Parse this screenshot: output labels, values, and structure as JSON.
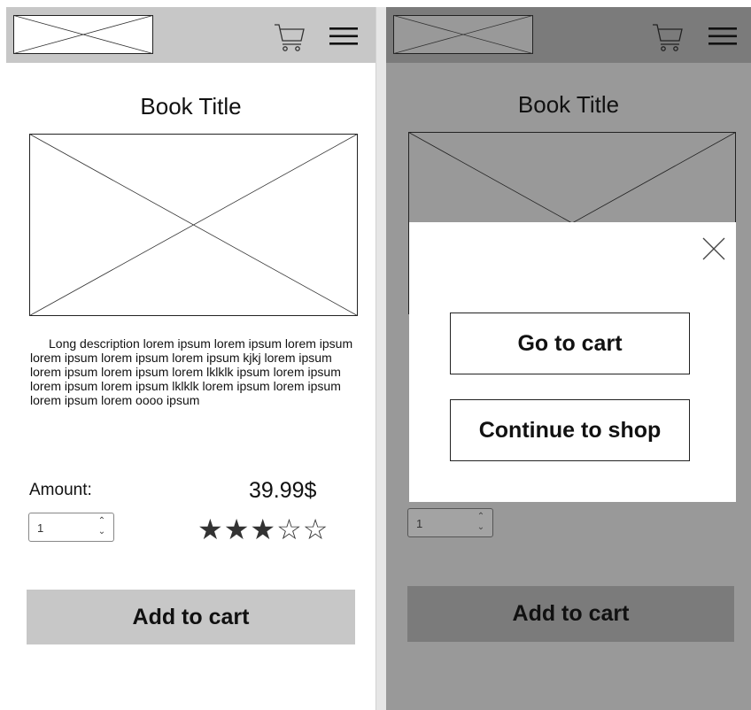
{
  "screens": {
    "product": {
      "book_title": "Book Title",
      "description": "Long description lorem ipsum lorem ipsum lorem ipsum lorem ipsum lorem ipsum lorem ipsum kjkj lorem ipsum lorem ipsum lorem ipsum lorem lklklk ipsum lorem ipsum lorem ipsum lorem ipsum lklklk lorem ipsum lorem ipsum lorem ipsum lorem oooo ipsum",
      "amount_label": "Amount:",
      "price": "39.99$",
      "quantity": "1",
      "rating": {
        "filled": 3,
        "total": 5,
        "display": "★★★☆☆"
      },
      "add_to_cart_label": "Add to cart",
      "icons": {
        "logo": "image-placeholder-icon",
        "cart": "shopping-cart-icon",
        "menu": "hamburger-menu-icon"
      }
    },
    "modal_open": {
      "book_title": "Book Title",
      "quantity": "1",
      "add_to_cart_label": "Add to cart",
      "modal": {
        "go_to_cart_label": "Go to cart",
        "continue_label": "Continue to shop",
        "close_icon": "close-icon"
      }
    }
  },
  "colors": {
    "header": "#c7c7c7",
    "overlay": "#999999",
    "header_dimmed": "#7b7b7b",
    "modal_background": "#ffffff"
  }
}
